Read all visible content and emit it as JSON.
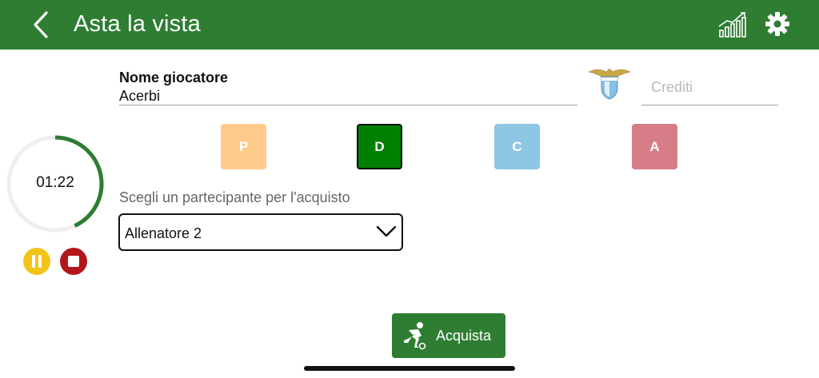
{
  "header": {
    "title": "Asta la vista",
    "back_icon": "chevron-left-icon",
    "stats_icon": "bar-chart-trend-icon",
    "settings_icon": "gear-icon",
    "color": "#2e7d32"
  },
  "timer": {
    "time": "01:22",
    "progress": 0.43,
    "progress_color": "#2e7d32",
    "track_color": "#eeeeee",
    "pause_color": "#f2c418",
    "stop_color": "#b3161c"
  },
  "player": {
    "name_label": "Nome giocatore",
    "name_value": "Acerbi",
    "club_logo": "lazio-crest-icon",
    "credits_placeholder": "Crediti",
    "credits_value": ""
  },
  "roles": [
    {
      "label": "P",
      "color": "#ffcb8a",
      "selected": false
    },
    {
      "label": "D",
      "color": "#008000",
      "selected": true
    },
    {
      "label": "C",
      "color": "#8fc6e4",
      "selected": false
    },
    {
      "label": "A",
      "color": "#d77d88",
      "selected": false
    }
  ],
  "participant": {
    "label": "Scegli un partecipante per l'acquisto",
    "selected": "Allenatore 2"
  },
  "buy_button": {
    "label": "Acquista",
    "icon": "soccer-player-kick-icon"
  }
}
